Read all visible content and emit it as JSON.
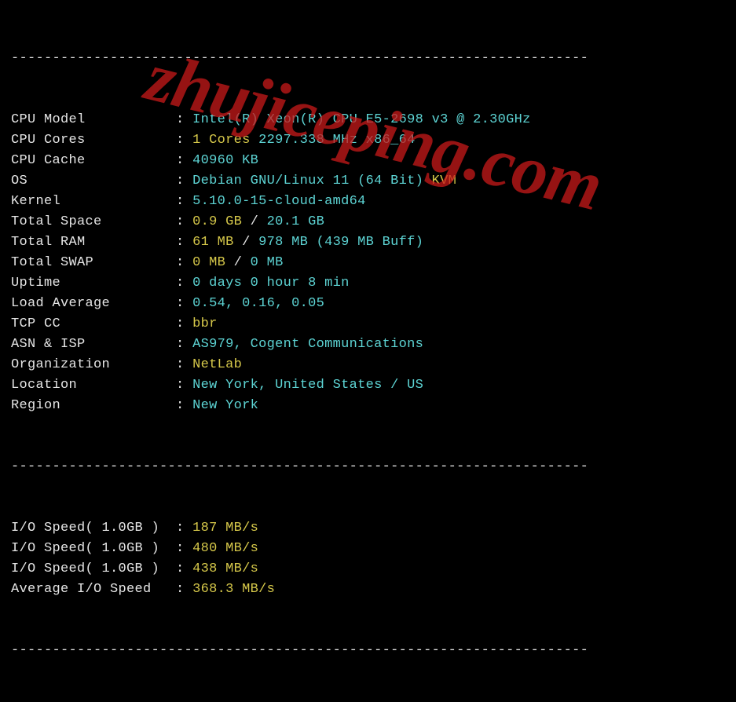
{
  "sep": "----------------------------------------------------------------------",
  "rows": [
    {
      "label": "CPU Model           ",
      "parts": [
        {
          "t": "Intel(R) Xeon(R) CPU E5-2698 v3 @ 2.30GHz",
          "c": "cyan"
        }
      ]
    },
    {
      "label": "CPU Cores           ",
      "parts": [
        {
          "t": "1 Cores ",
          "c": "yellow"
        },
        {
          "t": "2297.338 MHz x86_64",
          "c": "cyan"
        }
      ]
    },
    {
      "label": "CPU Cache           ",
      "parts": [
        {
          "t": "40960 KB",
          "c": "cyan"
        }
      ]
    },
    {
      "label": "OS                  ",
      "parts": [
        {
          "t": "Debian GNU/Linux 11 (64 Bit) ",
          "c": "cyan"
        },
        {
          "t": "KVM",
          "c": "yellow"
        }
      ]
    },
    {
      "label": "Kernel              ",
      "parts": [
        {
          "t": "5.10.0-15-cloud-amd64",
          "c": "cyan"
        }
      ]
    },
    {
      "label": "Total Space         ",
      "parts": [
        {
          "t": "0.9 GB ",
          "c": "yellow"
        },
        {
          "t": "/ ",
          "c": "white"
        },
        {
          "t": "20.1 GB",
          "c": "cyan"
        }
      ]
    },
    {
      "label": "Total RAM           ",
      "parts": [
        {
          "t": "61 MB ",
          "c": "yellow"
        },
        {
          "t": "/ ",
          "c": "white"
        },
        {
          "t": "978 MB ",
          "c": "cyan"
        },
        {
          "t": "(439 MB Buff)",
          "c": "cyan"
        }
      ]
    },
    {
      "label": "Total SWAP          ",
      "parts": [
        {
          "t": "0 MB ",
          "c": "yellow"
        },
        {
          "t": "/ ",
          "c": "white"
        },
        {
          "t": "0 MB",
          "c": "cyan"
        }
      ]
    },
    {
      "label": "Uptime              ",
      "parts": [
        {
          "t": "0 days 0 hour 8 min",
          "c": "cyan"
        }
      ]
    },
    {
      "label": "Load Average        ",
      "parts": [
        {
          "t": "0.54, 0.16, 0.05",
          "c": "cyan"
        }
      ]
    },
    {
      "label": "TCP CC              ",
      "parts": [
        {
          "t": "bbr",
          "c": "yellow"
        }
      ]
    },
    {
      "label": "ASN & ISP           ",
      "parts": [
        {
          "t": "AS979, Cogent Communications",
          "c": "cyan"
        }
      ]
    },
    {
      "label": "Organization        ",
      "parts": [
        {
          "t": "NetLab",
          "c": "yellow"
        }
      ]
    },
    {
      "label": "Location            ",
      "parts": [
        {
          "t": "New York, United States / US",
          "c": "cyan"
        }
      ]
    },
    {
      "label": "Region              ",
      "parts": [
        {
          "t": "New York",
          "c": "cyan"
        }
      ]
    }
  ],
  "io_rows": [
    {
      "label": "I/O Speed( 1.0GB )  ",
      "parts": [
        {
          "t": "187 MB/s",
          "c": "yellow"
        }
      ]
    },
    {
      "label": "I/O Speed( 1.0GB )  ",
      "parts": [
        {
          "t": "480 MB/s",
          "c": "yellow"
        }
      ]
    },
    {
      "label": "I/O Speed( 1.0GB )  ",
      "parts": [
        {
          "t": "438 MB/s",
          "c": "yellow"
        }
      ]
    },
    {
      "label": "Average I/O Speed   ",
      "parts": [
        {
          "t": "368.3 MB/s",
          "c": "yellow"
        }
      ]
    }
  ],
  "watermark": "zhujiceping.com"
}
